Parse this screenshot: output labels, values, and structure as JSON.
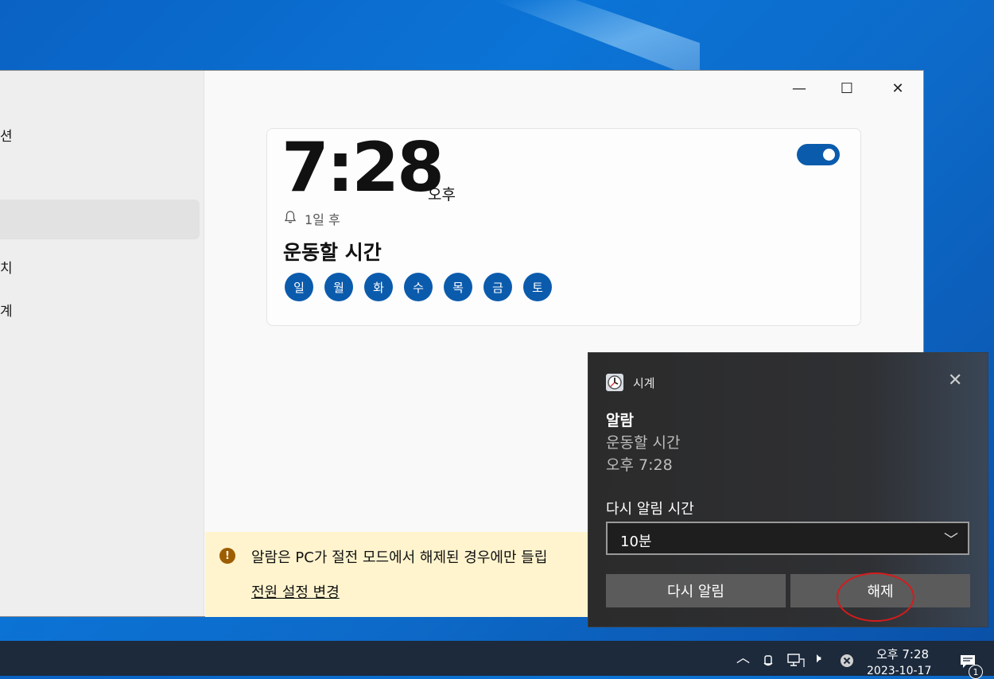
{
  "sidebar": {
    "items": [
      {
        "label": "션"
      },
      {
        "label": "치"
      },
      {
        "label": "계"
      }
    ]
  },
  "window_controls": {
    "minimize": "—",
    "maximize": "☐",
    "close": "✕"
  },
  "alarm": {
    "time": "7:28",
    "ampm": "오후",
    "remaining": "1일 후",
    "name": "운동할 시간",
    "enabled": true,
    "days": [
      "일",
      "월",
      "화",
      "수",
      "목",
      "금",
      "토"
    ]
  },
  "infobar": {
    "icon": "warning-icon",
    "text": "알람은 PC가 절전 모드에서 해제된 경우에만 들립",
    "link": "전원 설정 변경"
  },
  "toast": {
    "app_name": "시계",
    "title": "알람",
    "line1": "운동할 시간",
    "line2": "오후 7:28",
    "snooze_label": "다시 알림 시간",
    "snooze_value": "10분",
    "snooze_button": "다시 알림",
    "dismiss_button": "해제",
    "close": "✕"
  },
  "taskbar": {
    "time": "오후 7:28",
    "date": "2023-10-17",
    "notification_count": "1"
  },
  "colors": {
    "accent": "#0b5bad",
    "annotation": "#d51b1b",
    "infobar": "#fff4ce"
  }
}
